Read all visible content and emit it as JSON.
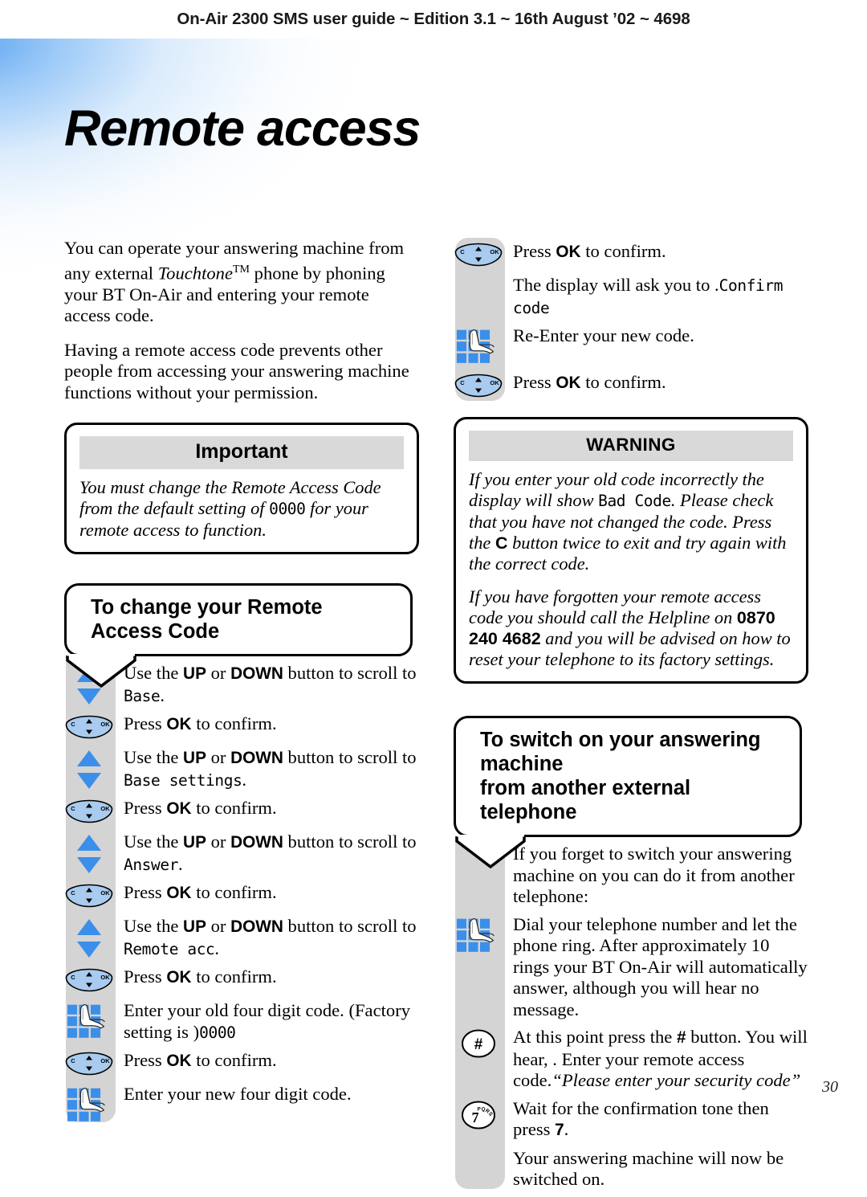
{
  "header": {
    "running_head": "On-Air 2300 SMS user guide ~ Edition 3.1 ~ 16th August ’02 ~ 4698"
  },
  "page": {
    "title": "Remote access",
    "number": "30"
  },
  "left_column": {
    "intro_paragraph_1_part1": "You can operate your answering machine from any external ",
    "intro_paragraph_1_trademark": "Touchtone",
    "intro_paragraph_1_tm": "TM",
    "intro_paragraph_1_part2": " phone by phoning your BT On-Air and entering your remote access code.",
    "intro_paragraph_2": "Having a remote access code prevents other people from accessing your answering machine functions without your permission.",
    "important_box": {
      "heading": "Important",
      "text_part1": "You must change the Remote Access Code from the default setting of ",
      "default_code": "0000",
      "text_part2": " for your remote access to function."
    },
    "section_callout": {
      "line1": "To change your Remote",
      "line2": "Access Code"
    },
    "steps": [
      {
        "icon": "up-down-arrows-icon",
        "text_part1": "Use the ",
        "bold1": "UP",
        "text_part2": " or ",
        "bold2": "DOWN",
        "text_part3": " button to scroll to ",
        "lcd": "Base",
        "text_part4": "."
      },
      {
        "icon": "ok-navigation-button-icon",
        "text_part1": "Press ",
        "bold1": "OK",
        "text_part2": " to confirm."
      },
      {
        "icon": "up-down-arrows-icon",
        "text_part1": "Use the ",
        "bold1": "UP",
        "text_part2": " or ",
        "bold2": "DOWN",
        "text_part3": " button to scroll to ",
        "lcd": "Base settings",
        "text_part4": "."
      },
      {
        "icon": "ok-navigation-button-icon",
        "text_part1": "Press ",
        "bold1": "OK",
        "text_part2": " to confirm."
      },
      {
        "icon": "up-down-arrows-icon",
        "text_part1": "Use the ",
        "bold1": "UP",
        "text_part2": " or ",
        "bold2": "DOWN",
        "text_part3": " button to scroll to ",
        "lcd": "Answer",
        "text_part4": "."
      },
      {
        "icon": "ok-navigation-button-icon",
        "text_part1": "Press ",
        "bold1": "OK",
        "text_part2": " to confirm."
      },
      {
        "icon": "up-down-arrows-icon",
        "text_part1": "Use the ",
        "bold1": "UP",
        "text_part2": " or ",
        "bold2": "DOWN",
        "text_part3": " button to scroll to ",
        "lcd": "Remote acc",
        "text_part4": "."
      },
      {
        "icon": "ok-navigation-button-icon",
        "text_part1": "Press ",
        "bold1": "OK",
        "text_part2": " to confirm."
      },
      {
        "icon": "keypad-icon",
        "text_part1": "Enter your old four digit code. (Factory setting is ",
        "lcd": "0000",
        "text_part2": ")"
      },
      {
        "icon": "ok-navigation-button-icon",
        "text_part1": "Press ",
        "bold1": "OK",
        "text_part2": " to confirm."
      },
      {
        "icon": "keypad-icon",
        "text_part1": "Enter your new four digit code."
      }
    ]
  },
  "right_column": {
    "steps_top": [
      {
        "icon": "ok-navigation-button-icon",
        "text_part1": "Press ",
        "bold1": "OK",
        "text_part2": " to confirm."
      },
      {
        "icon": "none",
        "text_part1": "The display will ask you to ",
        "lcd": "Confirm code",
        "text_part2": "."
      },
      {
        "icon": "keypad-icon",
        "text_part1": "Re-Enter your new code."
      },
      {
        "icon": "ok-navigation-button-icon",
        "text_part1": "Press ",
        "bold1": "OK",
        "text_part2": " to confirm."
      }
    ],
    "warning_box": {
      "heading": "WARNING",
      "para1_part1": "If you enter your old code incorrectly the display will show ",
      "para1_lcd": "Bad Code",
      "para1_part2": ". Please check that you have not changed the code. Press the ",
      "para1_bold": "C",
      "para1_part3": " button twice to exit and try again with the correct code.",
      "para2_part1": "If you have forgotten your remote access code you should call the Helpline on ",
      "para2_phone": "0870 240 4682",
      "para2_part2": " and you will be advised on how to reset your telephone to its factory settings."
    },
    "section_callout": {
      "line1": "To switch on your answering machine",
      "line2": "from another external telephone"
    },
    "steps_bottom": [
      {
        "icon": "none",
        "text_part1": "If you forget to switch your answering machine on you can do it from another telephone:"
      },
      {
        "icon": "keypad-icon",
        "text_part1": "Dial your telephone number and let the phone ring. After approximately 10 rings your BT On-Air will automatically answer, although you will hear no message."
      },
      {
        "icon": "hash-key-icon",
        "icon_label": "#",
        "text_part1": "At this point press the ",
        "bold1": "#",
        "text_part2": " button. You will hear, ",
        "italic1": "“Please enter your security code”",
        "text_part3": ". Enter your remote access code."
      },
      {
        "icon": "seven-key-icon",
        "icon_label": "7",
        "icon_sublabel": "PQRS",
        "text_part1": "Wait for the confirmation tone then press ",
        "bold1": "7",
        "text_part2": "."
      },
      {
        "icon": "none",
        "text_part1": "Your answering machine will now be switched on."
      }
    ]
  },
  "colors": {
    "arrow_blue": "#3B8FEA",
    "button_blue": "#A8CBEF",
    "band_grey": "#D4D4D4",
    "head_grey": "#D9D9D9"
  }
}
